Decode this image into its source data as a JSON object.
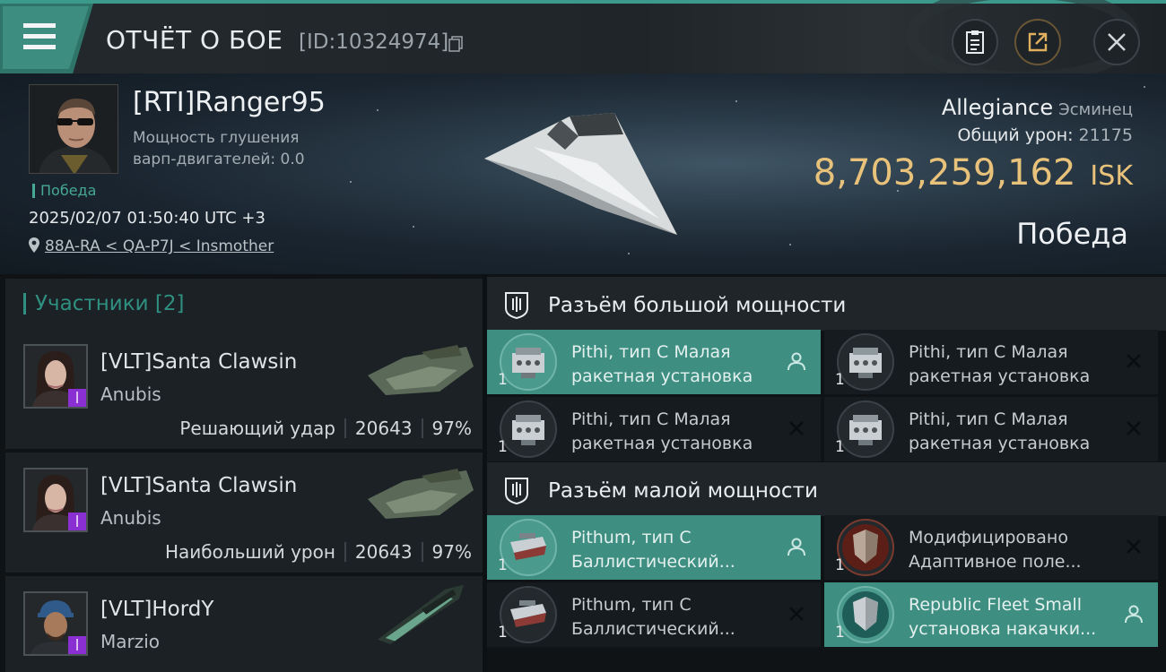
{
  "header": {
    "title": "ОТЧЁТ О БОЕ",
    "report_id": "[ID:10324974]"
  },
  "victim": {
    "name": "[RTI]Ranger95",
    "warp_line1": "Мощность глушения",
    "warp_line2": "варп-двигателей: 0.0",
    "result_small": "Победа",
    "datetime": "2025/02/07 01:50:40 UTC +3",
    "location": "88A-RA < QA-P7J < Insmother",
    "ship_name": "Allegiance",
    "ship_class": "Эсминец",
    "damage_label": "Общий урон:",
    "damage_value": "21175",
    "isk_value": "8,703,259,162",
    "isk_currency": "ISK",
    "result_big": "Победа"
  },
  "participants": {
    "title": "Участники [2]",
    "items": [
      {
        "name": "[VLT]Santa Clawsin",
        "ship": "Anubis",
        "label": "Решающий удар",
        "damage": "20643",
        "percent": "97%"
      },
      {
        "name": "[VLT]Santa Clawsin",
        "ship": "Anubis",
        "label": "Наибольший урон",
        "damage": "20643",
        "percent": "97%"
      },
      {
        "name": "[VLT]HordY",
        "ship": "Marzio"
      }
    ]
  },
  "high_slots": {
    "title": "Разъём большой мощности",
    "items": [
      {
        "qty": "1",
        "line1": "Pithi, тип C Малая",
        "line2": "ракетная установка"
      },
      {
        "qty": "1",
        "line1": "Pithi, тип C Малая",
        "line2": "ракетная установка"
      },
      {
        "qty": "1",
        "line1": "Pithi, тип C Малая",
        "line2": "ракетная установка"
      },
      {
        "qty": "1",
        "line1": "Pithi, тип C Малая",
        "line2": "ракетная установка"
      }
    ]
  },
  "low_slots": {
    "title": "Разъём малой мощности",
    "items": [
      {
        "qty": "1",
        "line1": "Pithum, тип C",
        "line2": "Баллистический..."
      },
      {
        "qty": "1",
        "line1": "Модифицировано",
        "line2": "Адаптивное поле..."
      },
      {
        "qty": "1",
        "line1": "Pithum, тип C",
        "line2": "Баллистический..."
      },
      {
        "qty": "1",
        "line1": "Republic Fleet Small",
        "line2": "установка накачки..."
      }
    ]
  },
  "colors": {
    "accent": "#3e8f82",
    "isk": "#e8c27a",
    "badge": "#8a2fd1"
  }
}
